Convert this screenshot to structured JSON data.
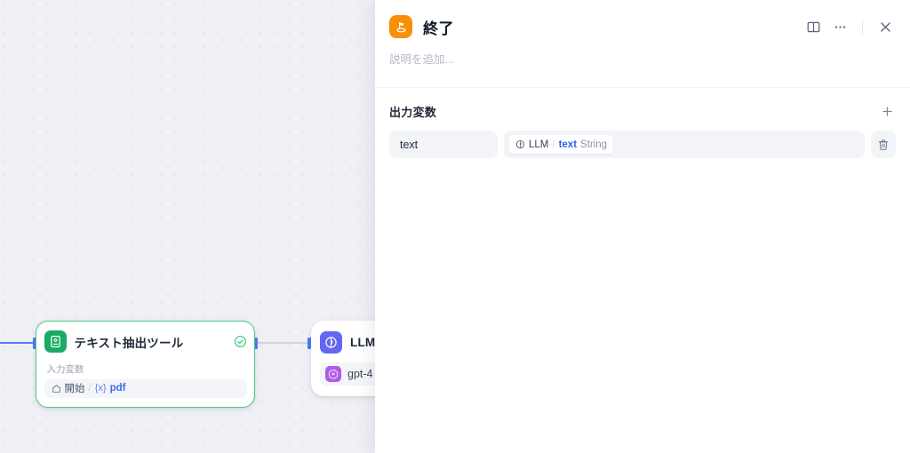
{
  "canvas": {
    "nodes": [
      {
        "id": "text-extractor",
        "title": "テキスト抽出ツール",
        "icon": "document-extract-icon",
        "icon_color": "#1AAB62",
        "status_icon": "check-circle-icon",
        "input_label": "入力変数",
        "input_variable": {
          "source_icon": "home-icon",
          "source": "開始",
          "separator": "/",
          "braces": "{x}",
          "key": "pdf"
        }
      },
      {
        "id": "llm",
        "title": "LLM",
        "icon": "llm-icon",
        "icon_color": "#6366F1",
        "model_icon": "openai-icon",
        "model_icon_color": "#B05CE6",
        "model": "gpt-4"
      }
    ]
  },
  "panel": {
    "icon": "end-node-icon",
    "icon_color": "#F79009",
    "title": "終了",
    "description_placeholder": "説明を追加...",
    "actions": {
      "panel_toggle": "panel-layout-icon",
      "more": "more-horizontal-icon",
      "close": "close-icon"
    },
    "output_section": {
      "title": "出力変数",
      "add_icon": "plus-icon",
      "rows": [
        {
          "name": "text",
          "value": {
            "chip_icon": "variable-circle-icon",
            "node": "LLM",
            "separator": "/",
            "key": "text",
            "type": "String"
          },
          "delete_icon": "trash-icon"
        }
      ]
    }
  }
}
